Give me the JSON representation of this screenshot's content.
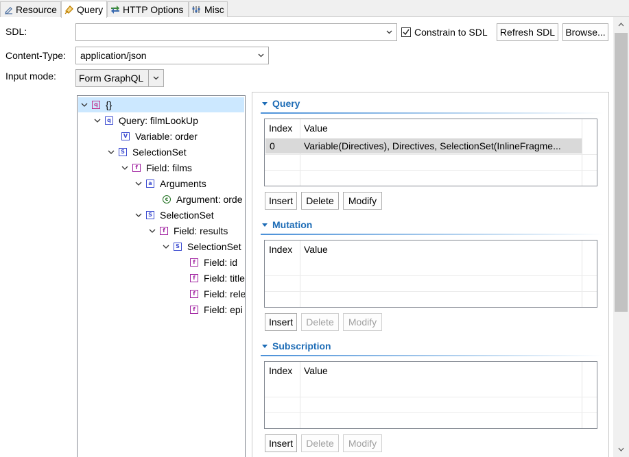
{
  "tabs": [
    {
      "label": "Resource",
      "icon": "resource-icon"
    },
    {
      "label": "Query",
      "icon": "query-icon"
    },
    {
      "label": "HTTP Options",
      "icon": "http-options-icon"
    },
    {
      "label": "Misc",
      "icon": "misc-icon"
    }
  ],
  "sdl": {
    "label": "SDL:",
    "value": "",
    "constrain_label": "Constrain to SDL",
    "constrain_checked": true,
    "refresh_label": "Refresh SDL",
    "browse_label": "Browse..."
  },
  "content_type": {
    "label": "Content-Type:",
    "value": "application/json"
  },
  "input_mode": {
    "label": "Input mode:",
    "value": "Form GraphQL"
  },
  "tree": [
    {
      "label": "{}",
      "icon": "root",
      "glyph": "q"
    },
    {
      "label": "Query: filmLookUp",
      "icon": "q",
      "glyph": "q"
    },
    {
      "label": "Variable: order",
      "icon": "v",
      "glyph": "V"
    },
    {
      "label": "SelectionSet",
      "icon": "s",
      "glyph": "S"
    },
    {
      "label": "Field: films",
      "icon": "f",
      "glyph": "f"
    },
    {
      "label": "Arguments",
      "icon": "a",
      "glyph": "a"
    },
    {
      "label": "Argument: orde",
      "icon": "c",
      "glyph": "c"
    },
    {
      "label": "SelectionSet",
      "icon": "s",
      "glyph": "S"
    },
    {
      "label": "Field: results",
      "icon": "f",
      "glyph": "f"
    },
    {
      "label": "SelectionSet",
      "icon": "s",
      "glyph": "S"
    },
    {
      "label": "Field: id",
      "icon": "f",
      "glyph": "f"
    },
    {
      "label": "Field: title",
      "icon": "f",
      "glyph": "f"
    },
    {
      "label": "Field: rele",
      "icon": "f",
      "glyph": "f"
    },
    {
      "label": "Field: epi",
      "icon": "f",
      "glyph": "f"
    }
  ],
  "sections": {
    "query": {
      "title": "Query",
      "col_index": "Index",
      "col_value": "Value",
      "rows": [
        {
          "index": "0",
          "value": "Variable(Directives), Directives, SelectionSet(InlineFragme..."
        }
      ],
      "insert": "Insert",
      "delete": "Delete",
      "modify": "Modify"
    },
    "mutation": {
      "title": "Mutation",
      "col_index": "Index",
      "col_value": "Value",
      "rows": [],
      "insert": "Insert",
      "delete": "Delete",
      "modify": "Modify"
    },
    "subscription": {
      "title": "Subscription",
      "col_index": "Index",
      "col_value": "Value",
      "rows": [],
      "insert": "Insert",
      "delete": "Delete",
      "modify": "Modify"
    }
  }
}
